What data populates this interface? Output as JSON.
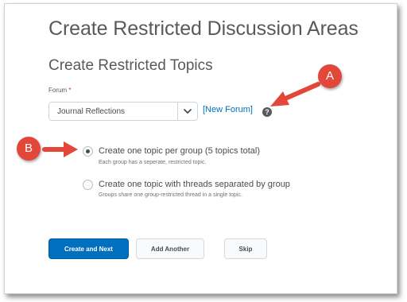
{
  "page": {
    "title": "Create Restricted Discussion Areas"
  },
  "section": {
    "title": "Create Restricted Topics"
  },
  "forum": {
    "label": "Forum",
    "required_mark": "*",
    "selected": "Journal Reflections",
    "new_forum_link": "[New Forum]",
    "help_icon": "?"
  },
  "options": [
    {
      "label": "Create one topic per group (5 topics total)",
      "description": "Each group has a seperate, restricted topic.",
      "selected": true
    },
    {
      "label": "Create one topic with threads separated by group",
      "description": "Groups share one group-restricted thread in a single topic.",
      "selected": false
    }
  ],
  "buttons": {
    "create_next": "Create and Next",
    "add_another": "Add Another",
    "skip": "Skip"
  },
  "annotations": {
    "a": "A",
    "b": "B",
    "color": "#e2473a"
  },
  "colors": {
    "accent": "#006fbf",
    "text": "#494c4e"
  },
  "icons": {
    "select": "chevron-down-icon",
    "help": "help-circle-icon",
    "radio": "radio-icon"
  }
}
